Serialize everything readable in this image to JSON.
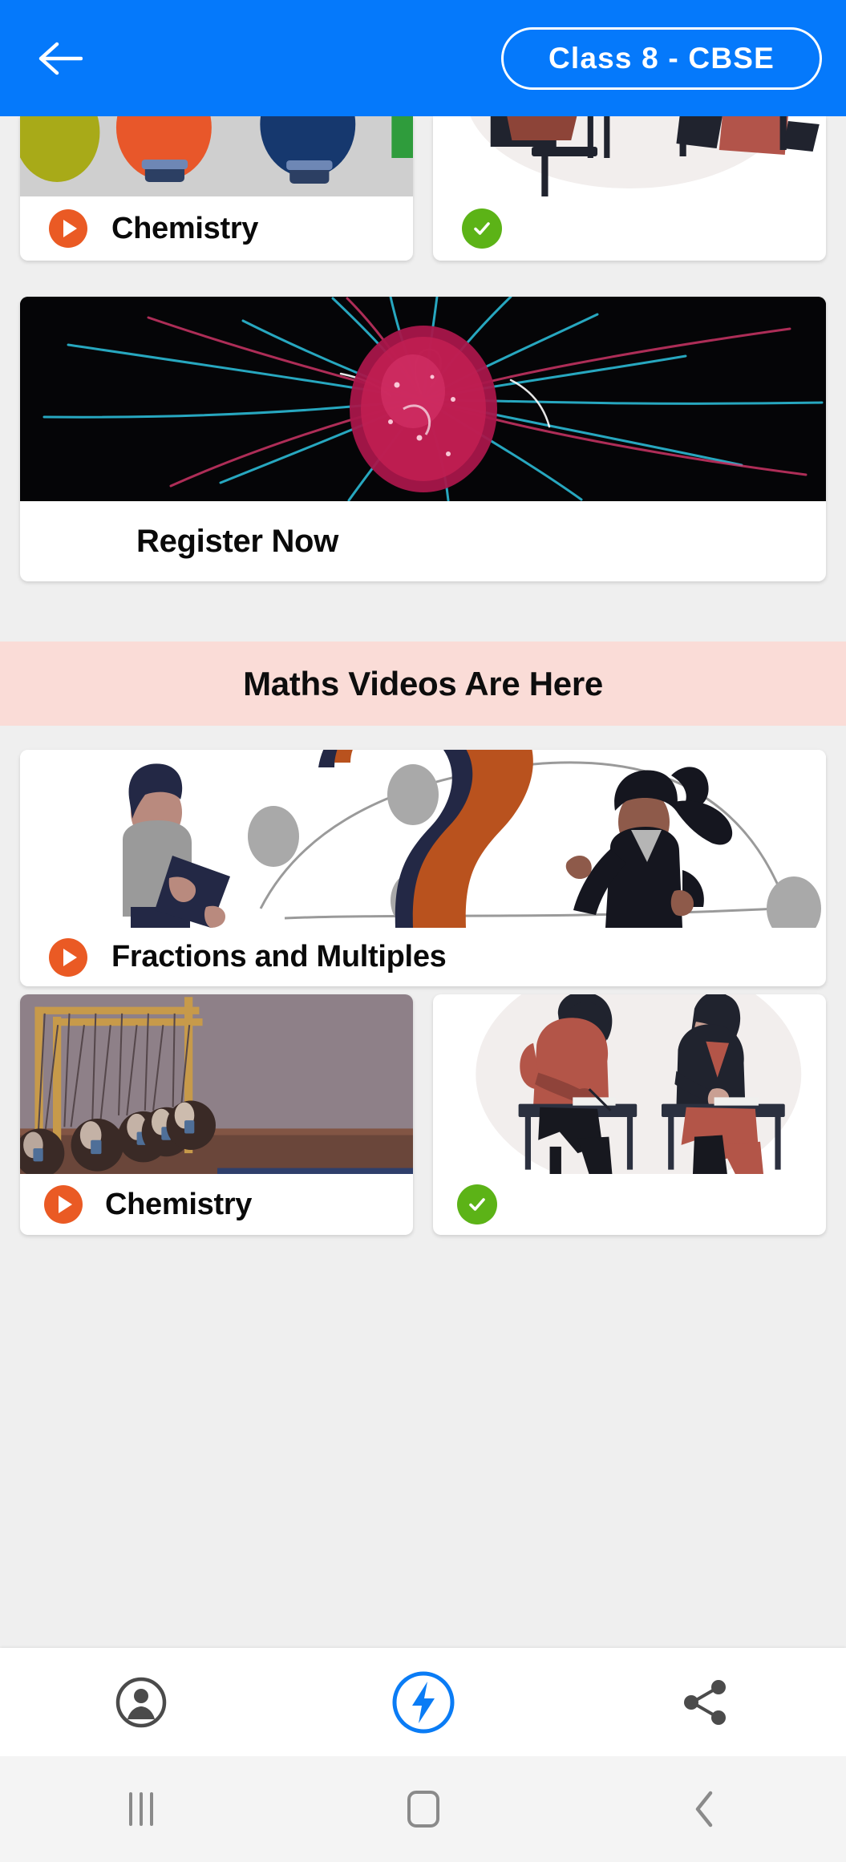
{
  "header": {
    "back_icon": "arrow-left-icon",
    "class_label": "Class 8 - CBSE",
    "bg_color": "#0579FB"
  },
  "theme": {
    "background": "#EFEFEF",
    "card_background": "#FFFFFF",
    "accent_blue": "#0579FB",
    "play_orange": "#EA5A24",
    "check_green": "#5CB317",
    "banner_pink": "#FADCD7",
    "title_color": "#0A0A0A"
  },
  "top_row": {
    "cards": [
      {
        "title": "Chemistry",
        "status_icon": "play-icon",
        "thumb": "balloons-photo"
      },
      {
        "title": "",
        "status_icon": "check-icon",
        "thumb": "students-exam-illustration"
      }
    ]
  },
  "hero_card": {
    "title": "Register Now",
    "thumb": "plasma-ball-photo"
  },
  "section_banner": {
    "title": "Maths Videos Are Here"
  },
  "maths_card": {
    "title": "Fractions and Multiples",
    "status_icon": "play-icon",
    "thumb": "question-mark-illustration"
  },
  "bottom_row": {
    "cards": [
      {
        "title": "Chemistry",
        "status_icon": "play-icon",
        "thumb": "newtons-cradle-photo"
      },
      {
        "title": "",
        "status_icon": "check-icon",
        "thumb": "students-exam-illustration"
      }
    ]
  },
  "bottom_nav": {
    "items": [
      {
        "icon": "account-circle-icon",
        "active": false
      },
      {
        "icon": "lightning-bolt-icon",
        "active": true
      },
      {
        "icon": "share-icon",
        "active": false
      }
    ]
  },
  "system_nav": {
    "items": [
      {
        "icon": "recents-icon"
      },
      {
        "icon": "home-icon"
      },
      {
        "icon": "back-chevron-icon"
      }
    ]
  }
}
